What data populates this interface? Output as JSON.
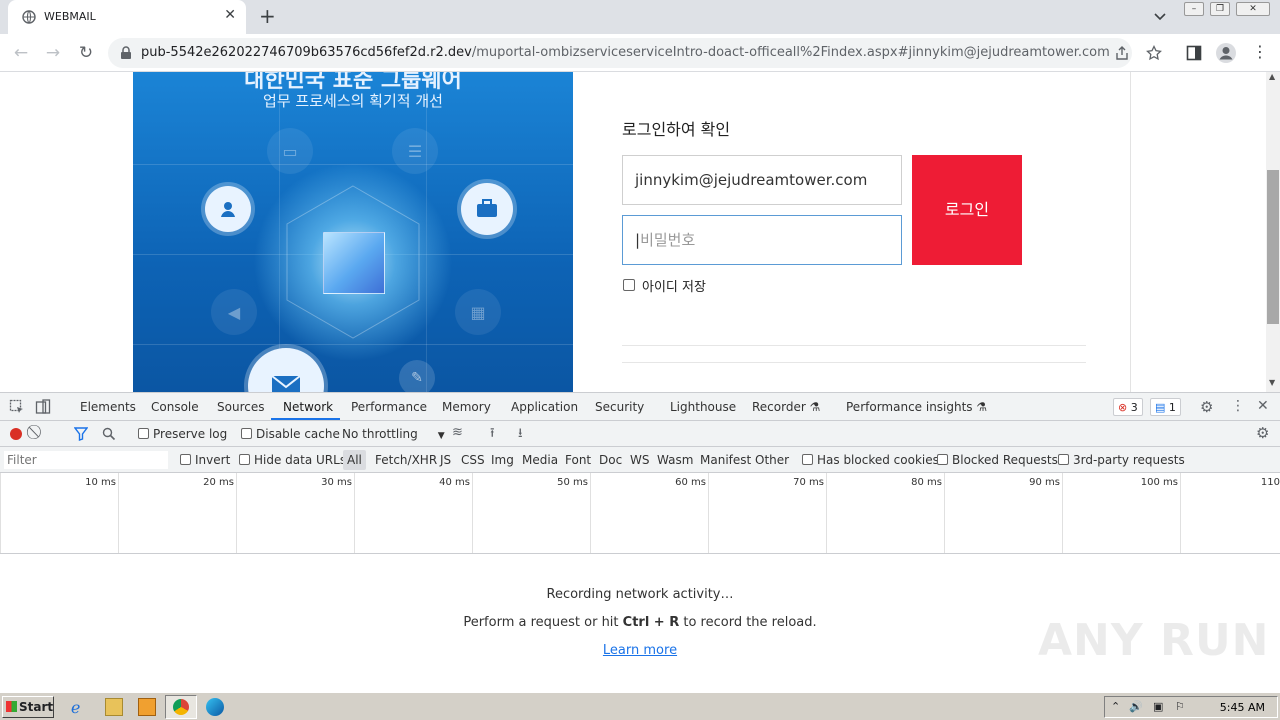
{
  "browser": {
    "tab_title": "WEBMAIL",
    "new_tab_icon": "+",
    "url_host": "pub-5542e262022746709b63576cd56fef2d.r2.dev",
    "url_path": "/muportal-ombizserviceserviceIntro-doact-officeall%2Findex.aspx#jinnykim@jejudreamtower.com"
  },
  "page": {
    "banner_title": "대한민국 표준 그룹웨어",
    "banner_subtitle": "업무 프로세스의 획기적 개선",
    "login_heading": "로그인하여 확인",
    "email_value": "jinnykim@jejudreamtower.com",
    "password_placeholder": "비밀번호",
    "login_button": "로그인",
    "remember_label": "아이디 저장"
  },
  "devtools": {
    "tabs": [
      "Elements",
      "Console",
      "Sources",
      "Network",
      "Performance",
      "Memory",
      "Application",
      "Security",
      "Lighthouse",
      "Recorder",
      "Performance insights"
    ],
    "active_tab": "Network",
    "errors_count": "3",
    "messages_count": "1",
    "toolbar": {
      "preserve_log": "Preserve log",
      "disable_cache": "Disable cache",
      "throttling": "No throttling"
    },
    "filter": {
      "placeholder": "Filter",
      "invert": "Invert",
      "hide_data_urls": "Hide data URLs",
      "types": [
        "All",
        "Fetch/XHR",
        "JS",
        "CSS",
        "Img",
        "Media",
        "Font",
        "Doc",
        "WS",
        "Wasm",
        "Manifest",
        "Other"
      ],
      "has_blocked_cookies": "Has blocked cookies",
      "blocked_requests": "Blocked Requests",
      "third_party": "3rd-party requests"
    },
    "timeline_ticks": [
      "10 ms",
      "20 ms",
      "30 ms",
      "40 ms",
      "50 ms",
      "60 ms",
      "70 ms",
      "80 ms",
      "90 ms",
      "100 ms",
      "110"
    ],
    "empty": {
      "line1": "Recording network activity…",
      "line2_prefix": "Perform a request or hit ",
      "line2_keys": "Ctrl + R",
      "line2_suffix": " to record the reload.",
      "learn_more": "Learn more"
    },
    "watermark": "ANY RUN"
  },
  "taskbar": {
    "start": "Start",
    "clock": "5:45 AM"
  },
  "colors": {
    "login_button": "#ee1c35",
    "banner_blue": "#0d63b5",
    "devtools_accent": "#1a73e8"
  }
}
